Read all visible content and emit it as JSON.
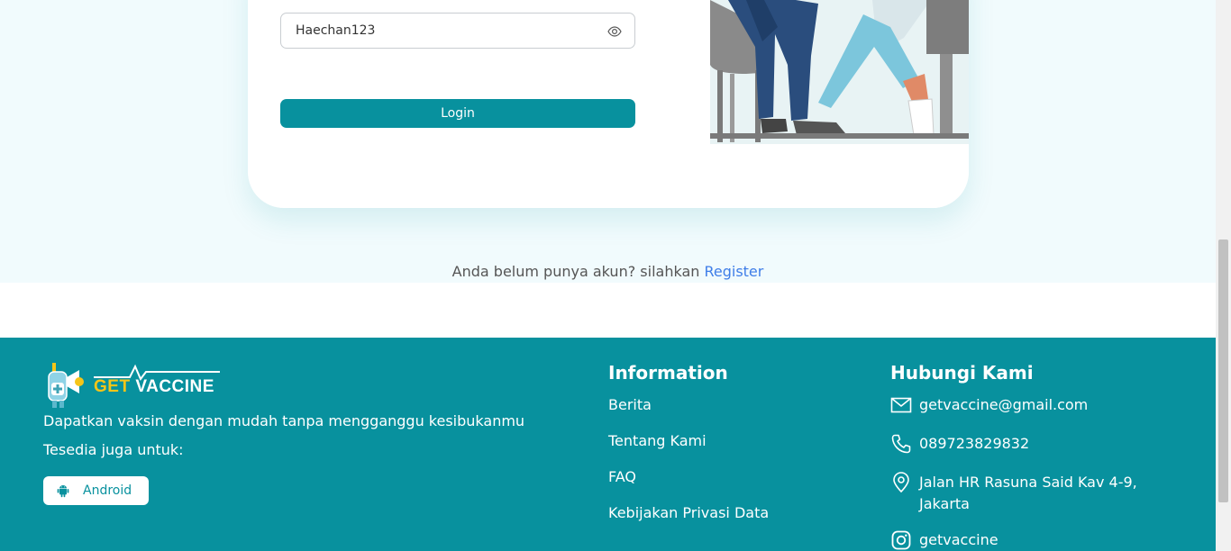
{
  "login_form": {
    "password_value": "Haechan123",
    "login_button_label": "Login"
  },
  "register_prompt": {
    "text": "Anda belum punya akun? silahkan ",
    "link_label": "Register"
  },
  "footer": {
    "brand": {
      "get": "GET",
      "vaccine": "VACCINE"
    },
    "tagline": "Dapatkan vaksin dengan mudah tanpa mengganggu kesibukanmu",
    "available_label": "Tesedia juga untuk:",
    "android_label": "Android",
    "information": {
      "title": "Information",
      "links": [
        "Berita",
        "Tentang Kami",
        "FAQ",
        "Kebijakan Privasi Data"
      ]
    },
    "contact": {
      "title": "Hubungi Kami",
      "email": "getvaccine@gmail.com",
      "phone": "089723829832",
      "address_line1": "Jalan HR Rasuna Said Kav 4-9,",
      "address_line2": "Jakarta",
      "instagram": "getvaccine"
    }
  },
  "colors": {
    "primary": "#08919e",
    "background_top": "#f1fbfd",
    "link": "#3f7ee8",
    "brand_yellow": "#f5c518"
  },
  "icons": [
    "eye-icon",
    "android-icon",
    "mail-icon",
    "phone-icon",
    "location-icon",
    "instagram-icon",
    "logo-mascot"
  ]
}
